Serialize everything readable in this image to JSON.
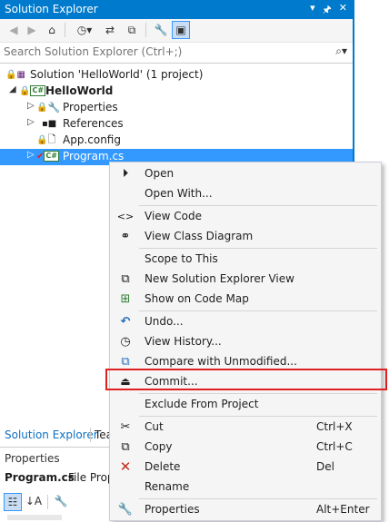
{
  "solution_explorer": {
    "title": "Solution Explorer",
    "title_buttons": [
      "▾",
      "🖈",
      "✕"
    ],
    "search_placeholder": "Search Solution Explorer (Ctrl+;)",
    "tree": [
      {
        "label": "Solution 'HelloWorld' (1 project)",
        "indent": 0
      },
      {
        "label": "HelloWorld",
        "indent": 1,
        "bold": true
      },
      {
        "label": "Properties",
        "indent": 2
      },
      {
        "label": "References",
        "indent": 2
      },
      {
        "label": "App.config",
        "indent": 2
      },
      {
        "label": "Program.cs",
        "indent": 2,
        "selected": true
      }
    ]
  },
  "bottom_tabs": [
    "Solution Explorer",
    "Tea"
  ],
  "properties": {
    "title": "Properties",
    "object_name": "Program.cs",
    "object_type": "File Prope"
  },
  "context_menu": {
    "items": [
      {
        "label": "Open",
        "icon": "open-icon",
        "shortcut": ""
      },
      {
        "label": "Open With...",
        "icon": "",
        "shortcut": ""
      },
      {
        "label": "View Code",
        "icon": "code-icon",
        "shortcut": ""
      },
      {
        "label": "View Class Diagram",
        "icon": "class-diagram-icon",
        "shortcut": ""
      },
      {
        "label": "Scope to This",
        "icon": "",
        "shortcut": ""
      },
      {
        "label": "New Solution Explorer View",
        "icon": "new-view-icon",
        "shortcut": ""
      },
      {
        "label": "Show on Code Map",
        "icon": "code-map-icon",
        "shortcut": ""
      },
      {
        "label": "Undo...",
        "icon": "undo-icon",
        "shortcut": ""
      },
      {
        "label": "View History...",
        "icon": "history-icon",
        "shortcut": ""
      },
      {
        "label": "Compare with Unmodified...",
        "icon": "compare-icon",
        "shortcut": ""
      },
      {
        "label": "Commit...",
        "icon": "commit-icon",
        "shortcut": ""
      },
      {
        "label": "Exclude From Project",
        "icon": "",
        "shortcut": ""
      },
      {
        "label": "Cut",
        "icon": "cut-icon",
        "shortcut": "Ctrl+X"
      },
      {
        "label": "Copy",
        "icon": "copy-icon",
        "shortcut": "Ctrl+C"
      },
      {
        "label": "Delete",
        "icon": "delete-icon",
        "shortcut": "Del"
      },
      {
        "label": "Rename",
        "icon": "",
        "shortcut": ""
      },
      {
        "label": "Properties",
        "icon": "wrench-icon",
        "shortcut": "Alt+Enter"
      }
    ]
  },
  "colors": {
    "accent": "#007acc",
    "selection": "#3399ff",
    "highlight_box": "#e02020"
  }
}
